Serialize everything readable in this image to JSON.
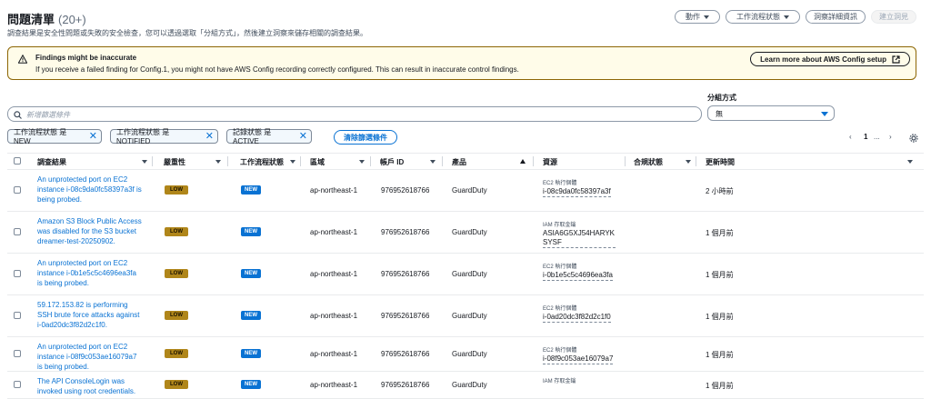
{
  "header": {
    "title": "問題清單",
    "count": "(20+)",
    "description": "調查結果是安全性問題或失敗的安全檢查，您可以透過選取「分組方式」，然後建立洞察來儲存相關的調查結果。",
    "buttons": {
      "actions": "動作",
      "workflow_status": "工作流程狀態",
      "view_details": "洞察詳細資訊",
      "create_insight": "建立洞見"
    }
  },
  "alert": {
    "title": "Findings might be inaccurate",
    "text": "If you receive a failed finding for Config.1, you might not have AWS Config recording correctly configured. This can result in inaccurate control findings.",
    "button": "Learn more about AWS Config setup"
  },
  "filters": {
    "search_placeholder": "新增篩選條件",
    "group_by_label": "分組方式",
    "group_by_value": "無",
    "chips": [
      "工作流程狀態 是 NEW",
      "工作流程狀態 是 NOTIFIED",
      "記錄狀態 是 ACTIVE"
    ],
    "clear": "清除篩選條件"
  },
  "pagination": {
    "page": "1",
    "ellipsis": "..."
  },
  "table": {
    "columns": [
      "調查結果",
      "嚴重性",
      "工作流程狀態",
      "區域",
      "帳戶 ID",
      "產品",
      "資源",
      "合規狀態",
      "更新時間"
    ],
    "rows": [
      {
        "finding": "An unprotected port on EC2 instance i-08c9da0fc58397a3f is being probed.",
        "severity": "LOW",
        "workflow": "NEW",
        "region": "ap-northeast-1",
        "account": "976952618766",
        "product": "GuardDuty",
        "resource_type": "EC2 執行個體",
        "resource_id": "i-08c9da0fc58397a3f",
        "updated": "2 小時前"
      },
      {
        "finding": "Amazon S3 Block Public Access was disabled for the S3 bucket dreamer-test-20250902.",
        "severity": "LOW",
        "workflow": "NEW",
        "region": "ap-northeast-1",
        "account": "976952618766",
        "product": "GuardDuty",
        "resource_type": "IAM 存取金鑰",
        "resource_id": "ASIA6G5XJ54HARYKSYSF",
        "updated": "1 個月前"
      },
      {
        "finding": "An unprotected port on EC2 instance i-0b1e5c5c4696ea3fa is being probed.",
        "severity": "LOW",
        "workflow": "NEW",
        "region": "ap-northeast-1",
        "account": "976952618766",
        "product": "GuardDuty",
        "resource_type": "EC2 執行個體",
        "resource_id": "i-0b1e5c5c4696ea3fa",
        "updated": "1 個月前"
      },
      {
        "finding": "59.172.153.82 is performing SSH brute force attacks against i-0ad20dc3f82d2c1f0.",
        "severity": "LOW",
        "workflow": "NEW",
        "region": "ap-northeast-1",
        "account": "976952618766",
        "product": "GuardDuty",
        "resource_type": "EC2 執行個體",
        "resource_id": "i-0ad20dc3f82d2c1f0",
        "updated": "1 個月前"
      },
      {
        "finding": "An unprotected port on EC2 instance i-08f9c053ae16079a7 is being probed.",
        "severity": "LOW",
        "workflow": "NEW",
        "region": "ap-northeast-1",
        "account": "976952618766",
        "product": "GuardDuty",
        "resource_type": "EC2 執行個體",
        "resource_id": "i-08f9c053ae16079a7",
        "updated": "1 個月前"
      },
      {
        "finding": "The API ConsoleLogin was invoked using root credentials.",
        "severity": "LOW",
        "workflow": "NEW",
        "region": "ap-northeast-1",
        "account": "976952618766",
        "product": "GuardDuty",
        "resource_type": "IAM 存取金鑰",
        "resource_id": "",
        "updated": "1 個月前"
      }
    ]
  }
}
